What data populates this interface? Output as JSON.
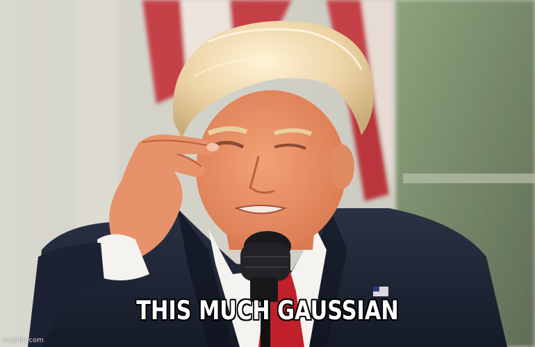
{
  "caption": {
    "text": "THIS MUCH GAUSSIAN"
  },
  "watermark": {
    "text": "imgflip.com"
  },
  "colors": {
    "caption_fill": "#ffffff",
    "caption_outline": "#000000",
    "background_left": "#d9d8cf",
    "background_right": "#6f7c69",
    "suit": "#1c2233",
    "tie": "#c0202a",
    "hair": "#e8cf9e",
    "skin": "#e58f63"
  }
}
